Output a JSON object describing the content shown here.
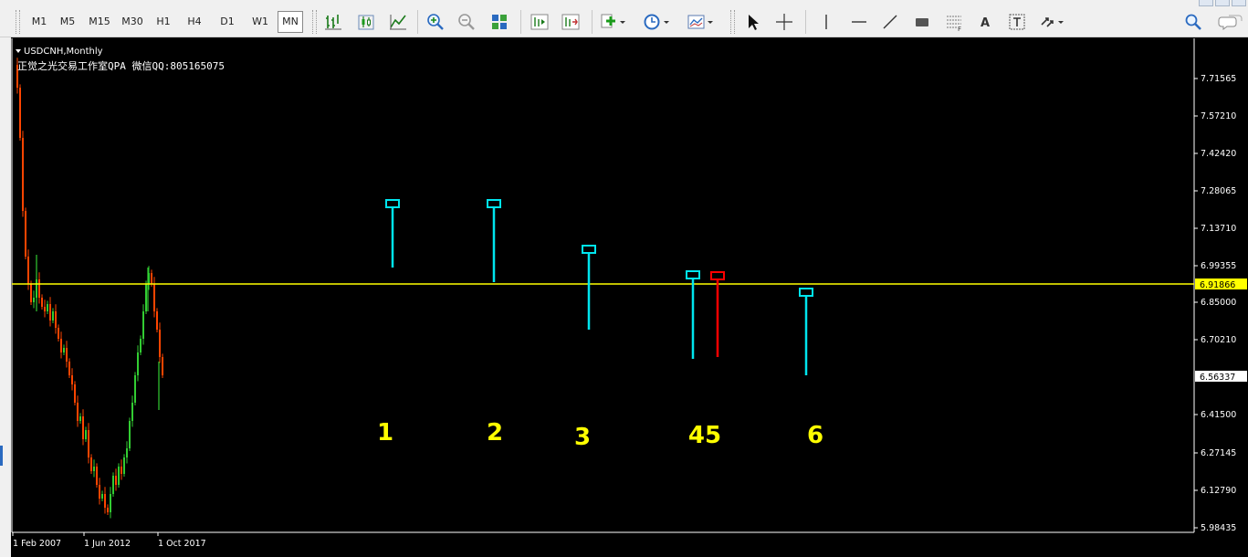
{
  "toolbar": {
    "timeframes": [
      "M1",
      "M5",
      "M15",
      "M30",
      "H1",
      "H4",
      "D1",
      "W1",
      "MN"
    ],
    "active_timeframe": "MN",
    "text_tool_label": "A"
  },
  "chart": {
    "symbol_label": "USDCNH,Monthly",
    "watermark": "正觉之光交易工作室QPA 微信QQ:805165075",
    "current_price": "6.91866",
    "highlight_price": "6.56337",
    "price_labels": [
      "7.71565",
      "7.57210",
      "7.42420",
      "7.28065",
      "7.13710",
      "6.99355",
      "6.85000",
      "6.70210",
      "6.41500",
      "6.27145",
      "6.12790",
      "5.98435"
    ],
    "date_labels": [
      "1 Feb 2007",
      "1 Jun 2012",
      "1 Oct 2017"
    ],
    "markers": [
      "1",
      "2",
      "3",
      "45",
      "6"
    ],
    "colors": {
      "background": "#000000",
      "bull_candle": "#32cd32",
      "bear_candle": "#ff4500",
      "current_price_line": "#ffff00",
      "marker_cyan": "#00e5ee",
      "marker_red": "#ff0000",
      "marker_text": "#ffff00",
      "axis_text": "#ffffff"
    }
  }
}
